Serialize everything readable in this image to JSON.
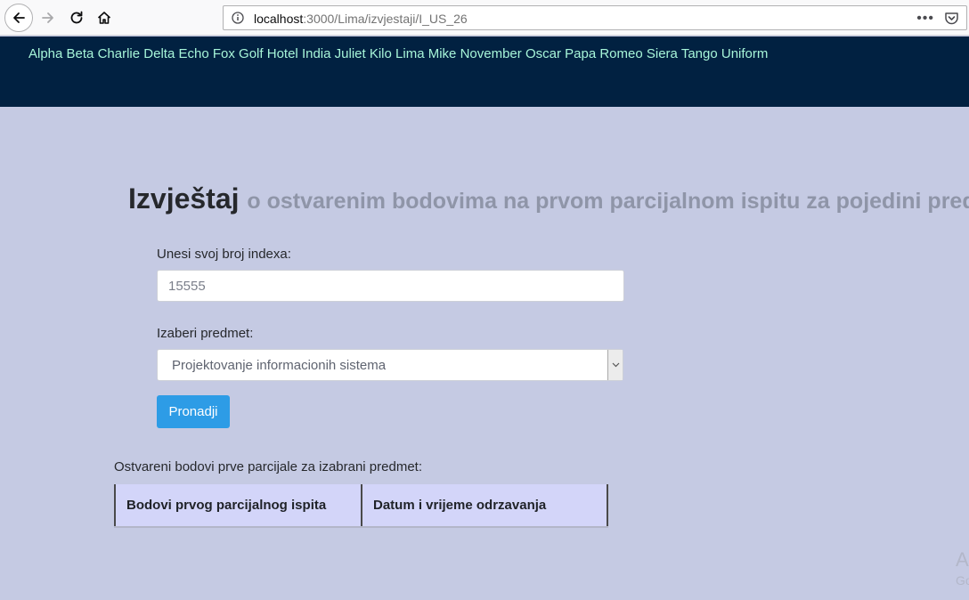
{
  "browser": {
    "url_host": "localhost",
    "url_path": ":3000/Lima/izvjestaji/I_US_26"
  },
  "navbar": {
    "links": [
      "Alpha",
      "Beta",
      "Charlie",
      "Delta",
      "Echo",
      "Fox",
      "Golf",
      "Hotel",
      "India",
      "Juliet",
      "Kilo",
      "Lima",
      "Mike",
      "November",
      "Oscar",
      "Papa",
      "Romeo",
      "Siera",
      "Tango",
      "Uniform"
    ],
    "color": "#012141",
    "link_color": "#a7f5d9"
  },
  "page": {
    "title": "Izvještaj",
    "subtitle": "o ostvarenim bodovima na prvom parcijalnom ispitu za pojedini predmet",
    "index_label": "Unesi svoj broj indexa:",
    "index_placeholder": "15555",
    "subject_label": "Izaberi predmet:",
    "subject_selected": "Projektovanje informacionih sistema",
    "find_button": "Pronadji",
    "results_label": "Ostvareni bodovi prve parcijale za izabrani predmet:",
    "table_headers": [
      "Bodovi prvog parcijalnog ispita",
      "Datum i vrijeme odrzavanja"
    ],
    "watermark_line1": "Ac",
    "watermark_line2": "Go"
  },
  "colors": {
    "background": "#c5cae3",
    "button": "#2d9ce6",
    "table_header_bg": "#d3d5f9"
  },
  "icons": [
    "back-arrow-icon",
    "forward-arrow-icon",
    "reload-icon",
    "home-icon",
    "info-icon",
    "more-icon",
    "pocket-icon",
    "chevron-down-icon"
  ]
}
